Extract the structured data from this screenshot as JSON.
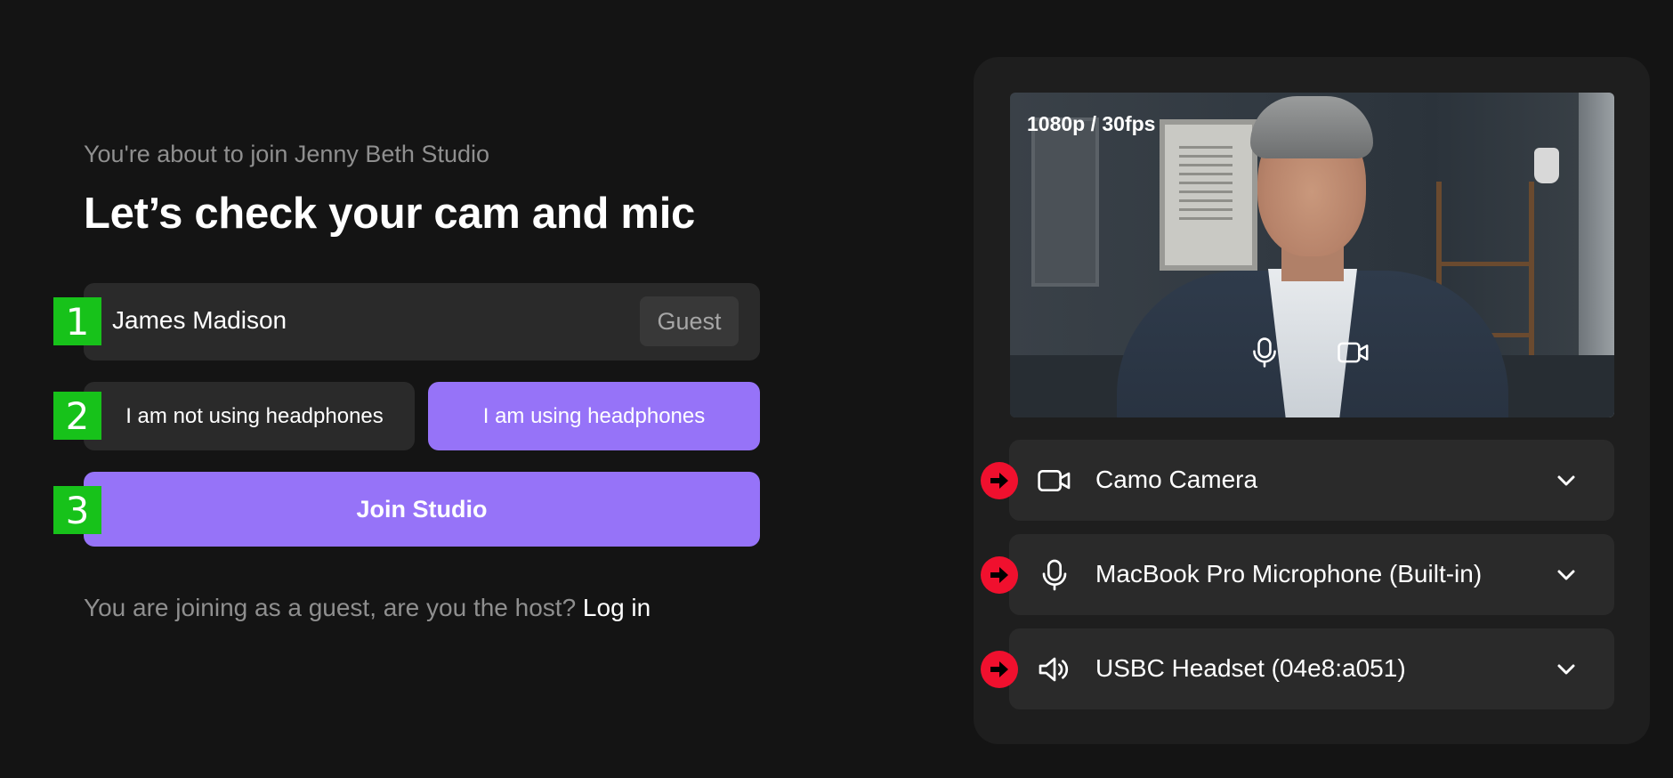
{
  "join": {
    "subtitle": "You're about to join Jenny Beth Studio",
    "heading": "Let’s check your cam and mic",
    "name_value": "James Madison",
    "role_badge": "Guest",
    "headphones_off_label": "I am not using headphones",
    "headphones_on_label": "I am using headphones",
    "join_button_label": "Join Studio",
    "guest_prompt": "You are joining as a guest, are you the host?",
    "login_link": "Log in",
    "steps": [
      "1",
      "2",
      "3"
    ]
  },
  "preview": {
    "resolution_label": "1080p / 30fps",
    "overlay_icons": [
      "microphone-icon",
      "video-camera-icon"
    ]
  },
  "devices": [
    {
      "icon": "video-camera-icon",
      "label": "Camo Camera"
    },
    {
      "icon": "microphone-icon",
      "label": "MacBook Pro Microphone (Built-in)"
    },
    {
      "icon": "speaker-icon",
      "label": "USBC Headset (04e8:a051)"
    }
  ],
  "colors": {
    "background": "#141414",
    "surface": "#2a2a2a",
    "panel": "#1e1e1e",
    "accent_purple": "#9673f8",
    "step_marker_green": "#17c21a",
    "arrow_marker_red": "#f0102e"
  }
}
